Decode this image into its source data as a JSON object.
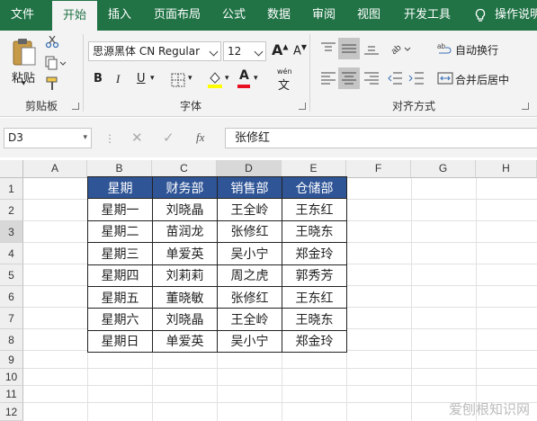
{
  "tabs": [
    {
      "label": "文件"
    },
    {
      "label": "开始"
    },
    {
      "label": "插入"
    },
    {
      "label": "页面布局"
    },
    {
      "label": "公式"
    },
    {
      "label": "数据"
    },
    {
      "label": "审阅"
    },
    {
      "label": "视图"
    },
    {
      "label": "开发工具"
    },
    {
      "label": "操作说明"
    }
  ],
  "active_tab": "开始",
  "ribbon": {
    "clipboard": {
      "paste_label": "粘贴",
      "group_label": "剪贴板"
    },
    "font": {
      "font_name": "思源黑体 CN Regular",
      "font_size": "12",
      "group_label": "字体",
      "bold": "B",
      "italic": "I",
      "underline": "U",
      "wen_label": "wén",
      "font_color": "#e81123",
      "fill_color": "#ffff00"
    },
    "alignment": {
      "wrap_text": "自动换行",
      "merge_center": "合并后居中",
      "group_label": "对齐方式"
    }
  },
  "formula_bar": {
    "name_box": "D3",
    "fx_label": "fx",
    "value": "张修红"
  },
  "columns": [
    "A",
    "B",
    "C",
    "D",
    "E",
    "F",
    "G",
    "H"
  ],
  "rows": [
    "1",
    "2",
    "3",
    "4",
    "5",
    "6",
    "7",
    "8",
    "9",
    "10",
    "11",
    "12"
  ],
  "table": {
    "headers": [
      "星期",
      "财务部",
      "销售部",
      "仓储部"
    ],
    "rows": [
      [
        "星期一",
        "刘晓晶",
        "王全岭",
        "王东红"
      ],
      [
        "星期二",
        "苗润龙",
        "张修红",
        "王晓东"
      ],
      [
        "星期三",
        "单爱英",
        "吴小宁",
        "郑金玲"
      ],
      [
        "星期四",
        "刘莉莉",
        "周之虎",
        "郭秀芳"
      ],
      [
        "星期五",
        "董晓敏",
        "张修红",
        "王东红"
      ],
      [
        "星期六",
        "刘晓晶",
        "王全岭",
        "王晓东"
      ],
      [
        "星期日",
        "单爱英",
        "吴小宁",
        "郑金玲"
      ]
    ],
    "header_bg": "#2f5597"
  },
  "watermark": "爱刨根知识网",
  "colors": {
    "accent": "#217346"
  }
}
